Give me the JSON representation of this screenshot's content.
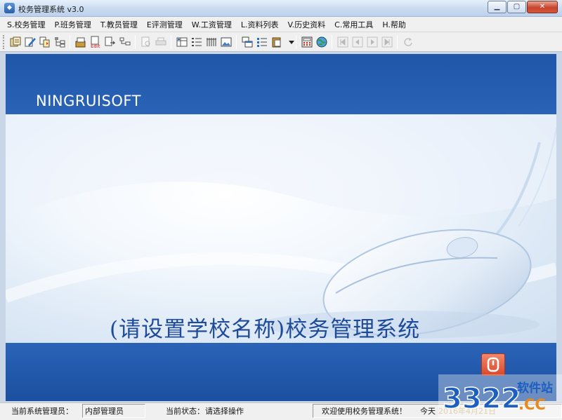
{
  "window": {
    "title": "校务管理系统 v3.0"
  },
  "menu": [
    "S.校务管理",
    "P.班务管理",
    "T.教员管理",
    "E评测管理",
    "W.工资管理",
    "L.资料列表",
    "V.历史资料",
    "C.常用工具",
    "H.帮助"
  ],
  "main": {
    "brand": "NINGRUISOFT",
    "school_title": "(请设置学校名称)校务管理系统"
  },
  "status": {
    "admin_label": "当前系统管理员：",
    "admin_value": "内部管理员",
    "state_label": "当前状态：",
    "state_value": "请选择操作",
    "welcome": "欢迎使用校务管理系统！",
    "today_label": "今天",
    "today_value": "2016年4月21日"
  },
  "watermark": {
    "brand": "3322",
    "suffix": ".CC",
    "tagline": "软件站"
  },
  "colors": {
    "band": "#2360b2",
    "title": "#1e4a9a",
    "power": "#d9482a"
  }
}
